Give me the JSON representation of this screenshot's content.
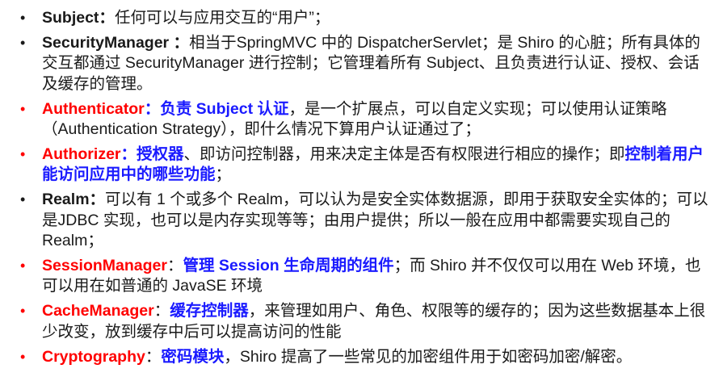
{
  "colors": {
    "term_highlight": "#ff0000",
    "emphasis": "#1a1aff",
    "text": "#1a1a1a"
  },
  "bullet_glyph": "•",
  "items": [
    {
      "term_color": "black",
      "segments": [
        {
          "style": "term",
          "text": "Subject："
        },
        {
          "style": "plain",
          "text": "任何可以与应用交互的“用户”；"
        }
      ]
    },
    {
      "term_color": "black",
      "segments": [
        {
          "style": "term",
          "text": "SecurityManager ："
        },
        {
          "style": "plain",
          "text": "相当于SpringMVC 中的 DispatcherServlet；是 Shiro 的心脏；所有具体的交互都通过 SecurityManager 进行控制；它管理着所有 Subject、且负责进行认证、授权、会话及缓存的管理。"
        }
      ]
    },
    {
      "term_color": "red",
      "segments": [
        {
          "style": "term-red",
          "text": "Authenticator"
        },
        {
          "style": "blue",
          "text": "：负责 Subject 认证"
        },
        {
          "style": "plain",
          "text": "，是一个扩展点，可以自定义实现；可以使用认证策略（Authentication Strategy），即什么情况下算用户认证通过了；"
        }
      ]
    },
    {
      "term_color": "red",
      "segments": [
        {
          "style": "term-red",
          "text": "Authorizer"
        },
        {
          "style": "blue",
          "text": "：授权器"
        },
        {
          "style": "plain",
          "text": "、即访问控制器，用来决定主体是否有权限进行相应的操作；即"
        },
        {
          "style": "blue",
          "text": "控制着用户能访问应用中的哪些功能"
        },
        {
          "style": "plain",
          "text": "；"
        }
      ]
    },
    {
      "term_color": "black",
      "segments": [
        {
          "style": "term",
          "text": "Realm："
        },
        {
          "style": "plain",
          "text": "可以有 1 个或多个 Realm，可以认为是安全实体数据源，即用于获取安全实体的；可以是JDBC 实现，也可以是内存实现等等；由用户提供；所以一般在应用中都需要实现自己的 Realm；"
        }
      ]
    },
    {
      "term_color": "red",
      "segments": [
        {
          "style": "term-red",
          "text": "SessionManager"
        },
        {
          "style": "plain",
          "text": "："
        },
        {
          "style": "blue",
          "text": "管理 Session 生命周期的组件"
        },
        {
          "style": "plain",
          "text": "；而 Shiro 并不仅仅可以用在 Web 环境，也可以用在如普通的 JavaSE 环境"
        }
      ]
    },
    {
      "term_color": "red",
      "segments": [
        {
          "style": "term-red",
          "text": "CacheManager"
        },
        {
          "style": "plain",
          "text": "："
        },
        {
          "style": "blue",
          "text": "缓存控制器"
        },
        {
          "style": "plain",
          "text": "，来管理如用户、角色、权限等的缓存的；因为这些数据基本上很少改变，放到缓存中后可以提高访问的性能"
        }
      ]
    },
    {
      "term_color": "red",
      "segments": [
        {
          "style": "term-red",
          "text": "Cryptography"
        },
        {
          "style": "plain",
          "text": "："
        },
        {
          "style": "blue",
          "text": "密码模块"
        },
        {
          "style": "plain",
          "text": "，Shiro 提高了一些常见的加密组件用于如密码加密/解密。"
        }
      ]
    }
  ]
}
